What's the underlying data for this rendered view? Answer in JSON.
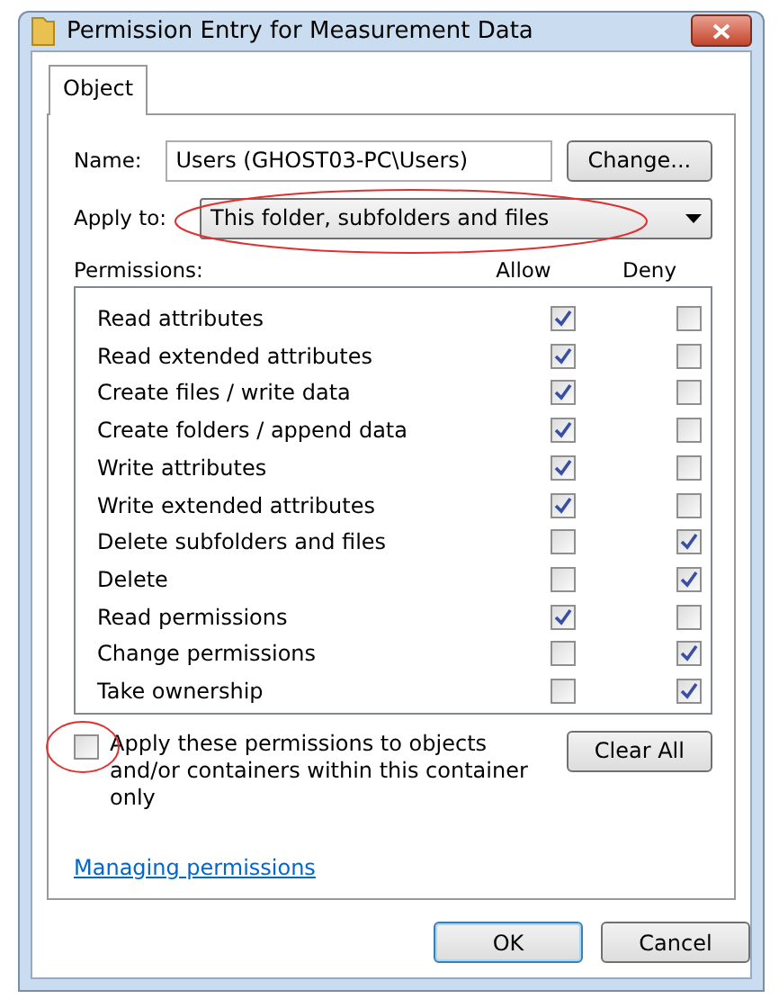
{
  "window": {
    "title": "Permission Entry for Measurement Data"
  },
  "tabs": [
    {
      "label": "Object",
      "selected": true
    }
  ],
  "name_field": {
    "label": "Name:",
    "value": "Users (GHOST03-PC\\Users)"
  },
  "change_button": "Change...",
  "apply_to": {
    "label": "Apply to:",
    "value": "This folder, subfolders and files"
  },
  "permissions": {
    "label": "Permissions:",
    "columns": [
      "Allow",
      "Deny"
    ],
    "rows": [
      {
        "name": "Read attributes",
        "allow": true,
        "deny": false
      },
      {
        "name": "Read extended attributes",
        "allow": true,
        "deny": false
      },
      {
        "name": "Create files / write data",
        "allow": true,
        "deny": false
      },
      {
        "name": "Create folders / append data",
        "allow": true,
        "deny": false
      },
      {
        "name": "Write attributes",
        "allow": true,
        "deny": false
      },
      {
        "name": "Write extended attributes",
        "allow": true,
        "deny": false
      },
      {
        "name": "Delete subfolders and files",
        "allow": false,
        "deny": true
      },
      {
        "name": "Delete",
        "allow": false,
        "deny": true
      },
      {
        "name": "Read permissions",
        "allow": true,
        "deny": false
      },
      {
        "name": "Change permissions",
        "allow": false,
        "deny": true
      },
      {
        "name": "Take ownership",
        "allow": false,
        "deny": true
      }
    ]
  },
  "apply_only": {
    "label": "Apply these permissions to objects and/or containers within this container only",
    "checked": false
  },
  "clear_all_button": "Clear All",
  "link": "Managing permissions",
  "buttons": [
    "OK",
    "Cancel"
  ]
}
